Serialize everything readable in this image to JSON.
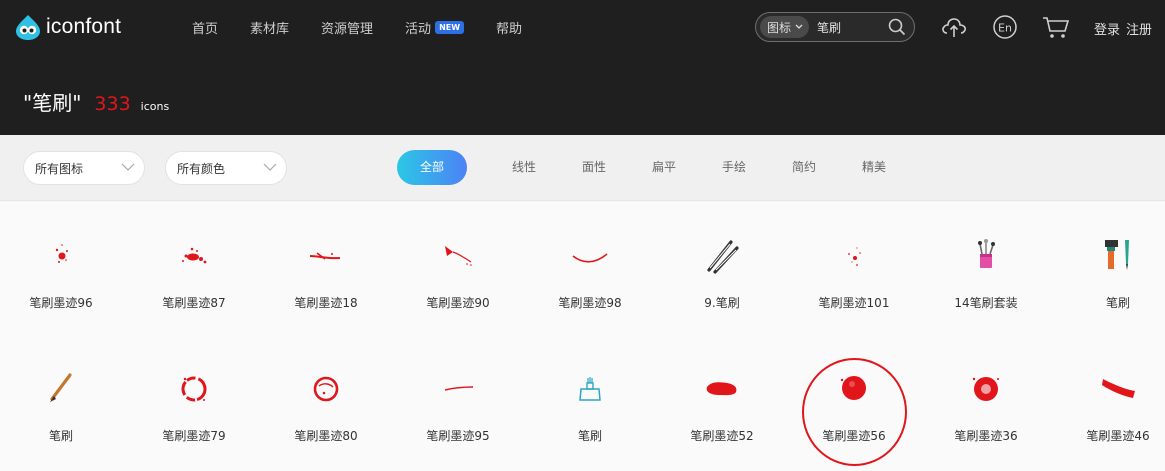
{
  "header": {
    "logo_text": "iconfont",
    "nav": [
      {
        "label": "首页"
      },
      {
        "label": "素材库"
      },
      {
        "label": "资源管理"
      },
      {
        "label": "活动",
        "badge": "NEW"
      },
      {
        "label": "帮助"
      }
    ],
    "search": {
      "type_label": "图标",
      "value": "笔刷"
    },
    "auth": {
      "login": "登录",
      "register": "注册"
    },
    "icons": [
      "upload-cloud-icon",
      "language-en-icon",
      "cart-icon"
    ]
  },
  "result": {
    "keyword": "\"笔刷\"",
    "count": "333",
    "unit": "icons"
  },
  "filters": {
    "icon_type": "所有图标",
    "color": "所有颜色",
    "styles": [
      "全部",
      "线性",
      "面性",
      "扁平",
      "手绘",
      "简约",
      "精美"
    ],
    "active_style": "全部"
  },
  "icons": [
    {
      "name": "笔刷墨迹96",
      "glyph": "splash-small"
    },
    {
      "name": "笔刷墨迹87",
      "glyph": "splash-big"
    },
    {
      "name": "笔刷墨迹18",
      "glyph": "streak"
    },
    {
      "name": "笔刷墨迹90",
      "glyph": "drip"
    },
    {
      "name": "笔刷墨迹98",
      "glyph": "arc"
    },
    {
      "name": "9.笔刷",
      "glyph": "brushes-pair"
    },
    {
      "name": "笔刷墨迹101",
      "glyph": "dots"
    },
    {
      "name": "14笔刷套装",
      "glyph": "brush-cup"
    },
    {
      "name": "笔刷",
      "glyph": "tools"
    },
    {
      "name": "笔刷",
      "glyph": "pencil-brush"
    },
    {
      "name": "笔刷墨迹79",
      "glyph": "ring"
    },
    {
      "name": "笔刷墨迹80",
      "glyph": "ring-rough"
    },
    {
      "name": "笔刷墨迹95",
      "glyph": "thin-stroke"
    },
    {
      "name": "笔刷",
      "glyph": "dustpan"
    },
    {
      "name": "笔刷墨迹52",
      "glyph": "blob-wide"
    },
    {
      "name": "笔刷墨迹56",
      "glyph": "blob-round"
    },
    {
      "name": "笔刷墨迹36",
      "glyph": "blob-ring"
    },
    {
      "name": "笔刷墨迹46",
      "glyph": "swoosh"
    }
  ],
  "colors": {
    "accent_red": "#e0161b",
    "header_bg": "#1f1f1f",
    "tab_gradient_start": "#2bc7e6",
    "tab_gradient_end": "#4c82f5"
  }
}
